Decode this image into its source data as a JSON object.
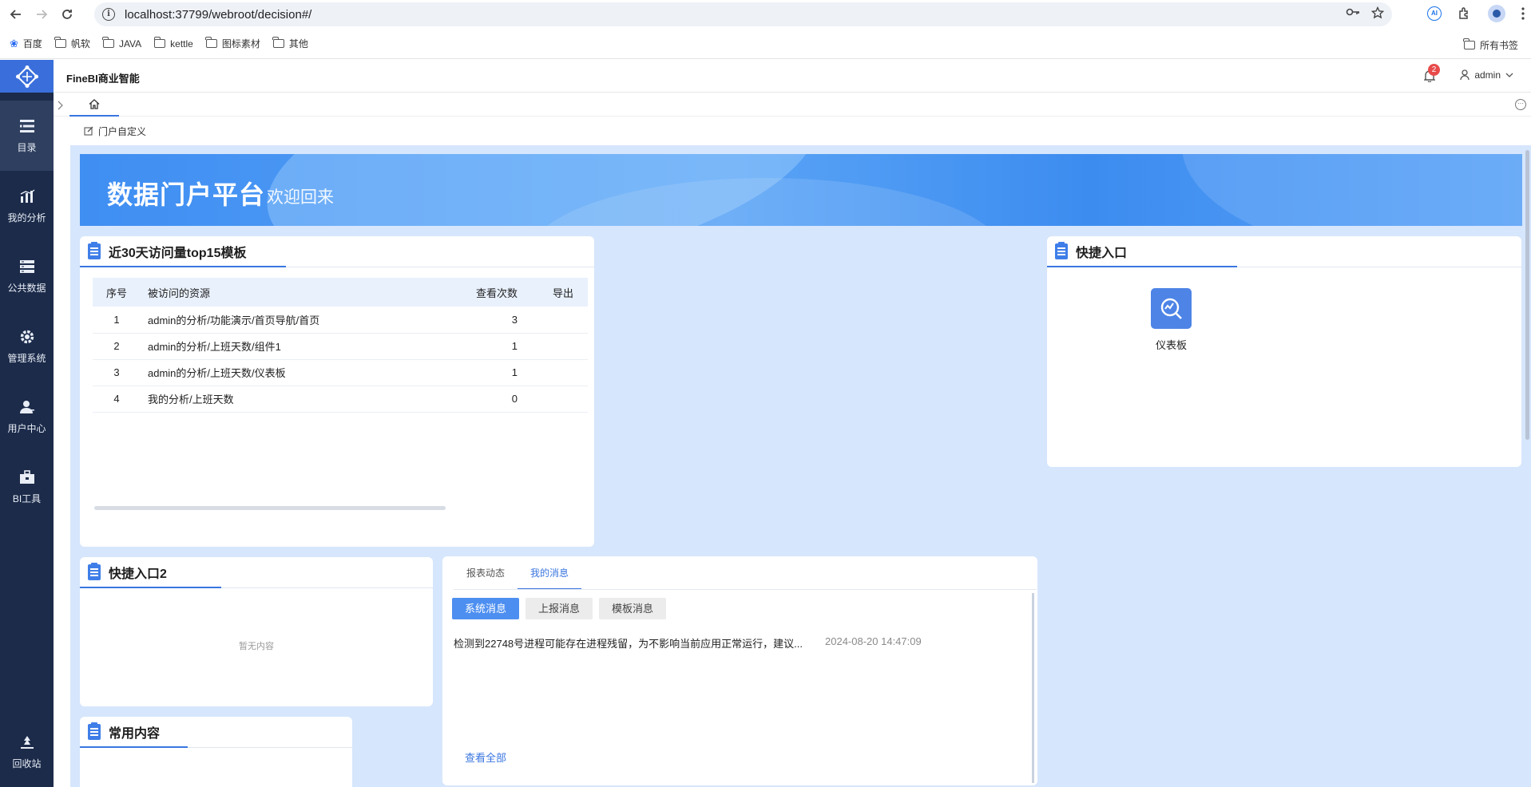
{
  "browser": {
    "url": "localhost:37799/webroot/decision#/",
    "bookmarks": [
      "百度",
      "帆软",
      "JAVA",
      "kettle",
      "图标素材",
      "其他"
    ],
    "bookmarks_right": "所有书签",
    "ai_badge": "AI"
  },
  "app": {
    "title": "FineBI商业智能",
    "notification_count": "2",
    "user": "admin"
  },
  "sidebar": {
    "items": [
      {
        "label": "目录",
        "icon": "catalog-icon",
        "active": true
      },
      {
        "label": "我的分析",
        "icon": "analysis-icon"
      },
      {
        "label": "公共数据",
        "icon": "database-icon"
      },
      {
        "label": "管理系统",
        "icon": "gear-icon"
      },
      {
        "label": "用户中心",
        "icon": "user-icon"
      },
      {
        "label": "BI工具",
        "icon": "toolbox-icon"
      }
    ],
    "bottom": {
      "label": "回收站",
      "icon": "recycle-icon"
    }
  },
  "toolbar": {
    "customize": "门户自定义",
    "more": "···"
  },
  "banner": {
    "title": "数据门户平台",
    "subtitle": "欢迎回来"
  },
  "top15": {
    "title": "近30天访问量top15模板",
    "columns": [
      "序号",
      "被访问的资源",
      "查看次数",
      "导出"
    ],
    "rows": [
      {
        "idx": "1",
        "resource": "admin的分析/功能演示/首页导航/首页",
        "views": "3"
      },
      {
        "idx": "2",
        "resource": "admin的分析/上班天数/组件1",
        "views": "1"
      },
      {
        "idx": "3",
        "resource": "admin的分析/上班天数/仪表板",
        "views": "1"
      },
      {
        "idx": "4",
        "resource": "我的分析/上班天数",
        "views": "0"
      }
    ]
  },
  "quick": {
    "title": "快捷入口",
    "item_label": "仪表板"
  },
  "quick2": {
    "title": "快捷入口2",
    "empty": "暂无内容"
  },
  "common": {
    "title": "常用内容"
  },
  "messages": {
    "tabs": [
      "报表动态",
      "我的消息"
    ],
    "active_tab": 1,
    "subtabs": [
      "系统消息",
      "上报消息",
      "模板消息"
    ],
    "items": [
      {
        "text": "检测到22748号进程可能存在进程残留，为不影响当前应用正常运行，建议...",
        "time": "2024-08-20 14:47:09"
      }
    ],
    "see_all": "查看全部"
  },
  "colors": {
    "sidebar": "#1c2b4a",
    "accent": "#3a76e0",
    "canvas": "#d6e6fc"
  }
}
